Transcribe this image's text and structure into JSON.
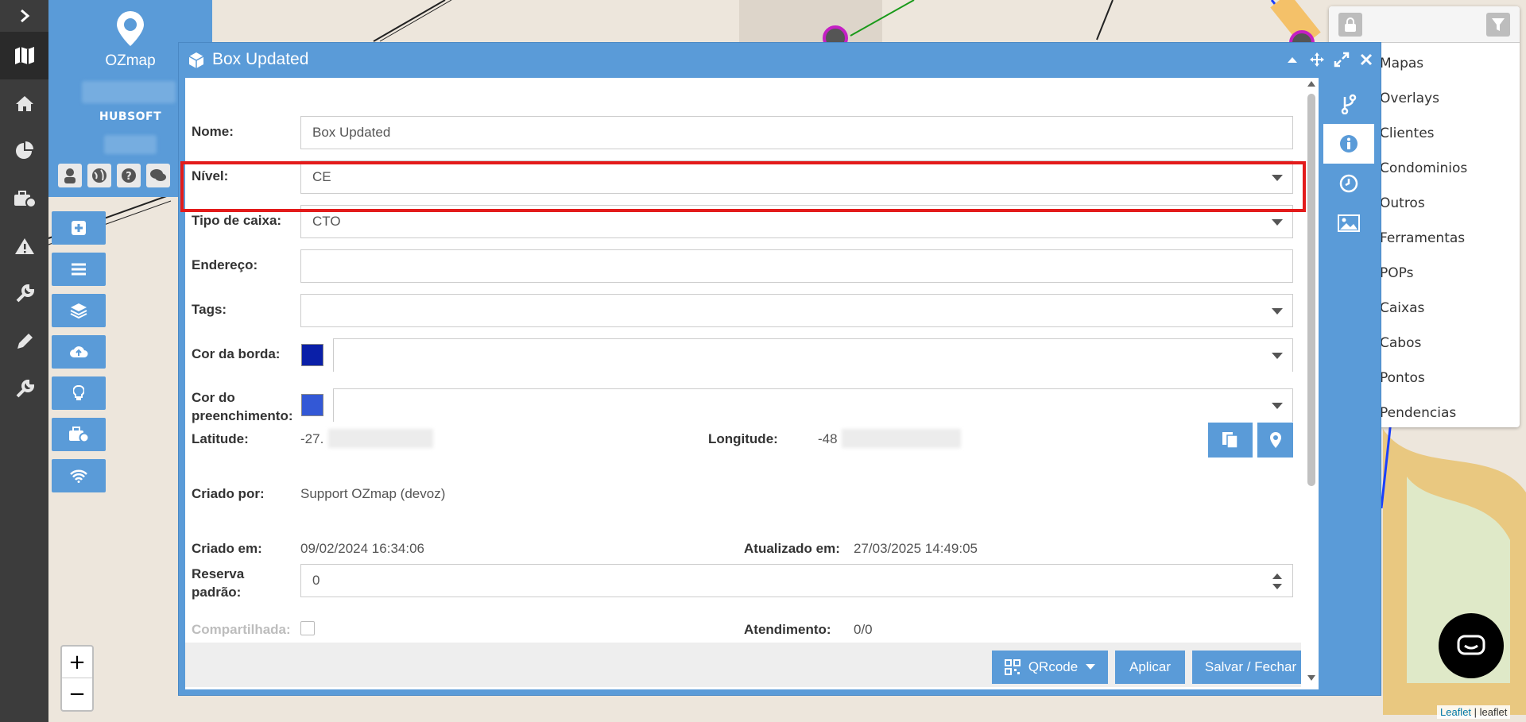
{
  "app": {
    "brand": "OZmap",
    "client": "HUBSOFT"
  },
  "dialog": {
    "title": "Box Updated",
    "fields": {
      "nome": {
        "label": "Nome:",
        "value": "Box Updated"
      },
      "nivel": {
        "label": "Nível:",
        "value": "CE"
      },
      "tipo": {
        "label": "Tipo de caixa:",
        "value": "CTO"
      },
      "endereco": {
        "label": "Endereço:",
        "value": ""
      },
      "tags": {
        "label": "Tags:",
        "value": ""
      },
      "cor_borda": {
        "label": "Cor da borda:",
        "value": "",
        "color": "#0a1fa8"
      },
      "cor_preench": {
        "label_line1": "Cor do",
        "label_line2": "preenchimento:",
        "value": "",
        "color": "#3358d6"
      },
      "latitude": {
        "label": "Latitude:",
        "value": "-27."
      },
      "longitude": {
        "label": "Longitude:",
        "value": "-48"
      },
      "criado_por": {
        "label": "Criado por:",
        "value": "Support OZmap (devoz)"
      },
      "criado_em": {
        "label": "Criado em:",
        "value": "09/02/2024 16:34:06"
      },
      "atualizado_em": {
        "label": "Atualizado em:",
        "value": "27/03/2025 14:49:05"
      },
      "reserva": {
        "label_line1": "Reserva",
        "label_line2": "padrão:",
        "value": "0"
      },
      "compartilhada": {
        "label": "Compartilhada:"
      },
      "atendimento": {
        "label": "Atendimento:",
        "value": "0/0"
      }
    },
    "footer": {
      "qrcode": "QRcode",
      "aplicar": "Aplicar",
      "salvar": "Salvar / Fechar"
    }
  },
  "layers": {
    "items": [
      "Mapas",
      "Overlays",
      "Clientes",
      "Condominios",
      "Outros",
      "Ferramentas",
      "POPs",
      "Caixas",
      "Cabos",
      "Pontos",
      "Pendencias"
    ]
  },
  "attribution": {
    "link": "Leaflet",
    "sep": " | ",
    "text": "leaflet"
  },
  "colors": {
    "accent": "#5a9bd8",
    "highlight": "#e31b1b",
    "rail": "#3c3c3c"
  }
}
